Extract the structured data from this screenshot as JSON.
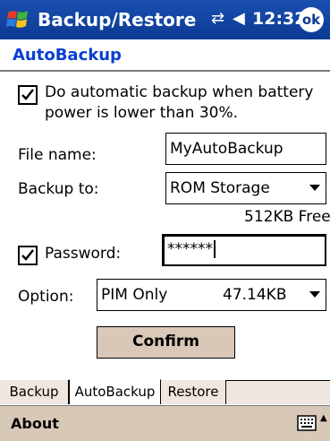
{
  "titlebar": {
    "title": "Backup/Restore",
    "time": "12:32",
    "ok_label": "ok"
  },
  "header": {
    "title": "AutoBackup"
  },
  "auto_backup": {
    "checked": true,
    "label_line1": "Do automatic backup when battery",
    "label_line2": "power is lower than 30%."
  },
  "file_name": {
    "label": "File name:",
    "value": "MyAutoBackup"
  },
  "backup_to": {
    "label": "Backup to:",
    "value": "ROM Storage",
    "free": "512KB Free"
  },
  "password": {
    "checked": true,
    "label": "Password:",
    "value": "******"
  },
  "option": {
    "label": "Option:",
    "value": "PIM Only",
    "size": "47.14KB"
  },
  "confirm_label": "Confirm",
  "tabs": [
    {
      "label": "Backup",
      "active": false
    },
    {
      "label": "AutoBackup",
      "active": true
    },
    {
      "label": "Restore",
      "active": false
    }
  ],
  "bottom": {
    "about_label": "About"
  },
  "colors": {
    "titlebar": "#0b3a93",
    "header": "#0a3fd0",
    "button": "#d9c8b8"
  }
}
